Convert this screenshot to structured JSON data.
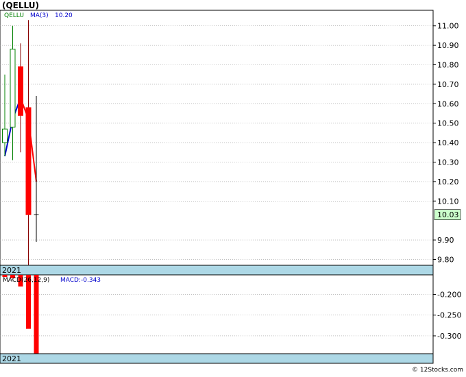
{
  "title": "(QELLU)",
  "copyright": "© 12Stocks.com",
  "chart_data": [
    {
      "type": "candlestick",
      "legend": {
        "symbol": "QELLU",
        "ma_label": "MA(3)",
        "ma_value": "10.20"
      },
      "ylim": [
        9.77,
        11.08
      ],
      "yticks": [
        11.0,
        10.9,
        10.8,
        10.7,
        10.6,
        10.5,
        10.4,
        10.3,
        10.2,
        10.1,
        9.9,
        9.8
      ],
      "ytick_labels": [
        "11.00",
        "10.90",
        "10.80",
        "10.70",
        "10.60",
        "10.50",
        "10.40",
        "10.30",
        "10.20",
        "10.10",
        "9.90",
        "9.80"
      ],
      "last_price_label": "10.03",
      "last_price": 10.03,
      "year_label": "2021",
      "candles": [
        {
          "open": 10.4,
          "high": 10.75,
          "low": 10.33,
          "close": 10.47,
          "direction": "up"
        },
        {
          "open": 10.48,
          "high": 11.0,
          "low": 10.31,
          "close": 10.88,
          "direction": "up"
        },
        {
          "open": 10.79,
          "high": 10.91,
          "low": 10.35,
          "close": 10.54,
          "direction": "down"
        },
        {
          "open": 10.58,
          "high": 11.03,
          "low": 9.77,
          "close": 10.03,
          "direction": "down"
        },
        {
          "open": 10.03,
          "high": 10.64,
          "low": 9.89,
          "close": 10.03,
          "direction": "flat"
        }
      ],
      "ma": [
        {
          "i": 0,
          "v": 10.33
        },
        {
          "i": 1,
          "v": 10.52
        },
        {
          "i": 2,
          "v": 10.63
        },
        {
          "i": 3,
          "v": 10.52
        },
        {
          "i": 4,
          "v": 10.2
        }
      ],
      "colors": {
        "up": "#008000",
        "down": "#ff0000",
        "flat": "#000000",
        "ma_up": "#0000cc",
        "ma_down": "#ff0000",
        "grid": "#999999",
        "bar": "#add8e6",
        "last_price_bg": "#ccffcc"
      }
    },
    {
      "type": "bar",
      "legend": {
        "name": "MACD(26,12,9)",
        "value_label": "MACD:-0.343"
      },
      "ylim": [
        -0.343,
        -0.153
      ],
      "yticks": [
        -0.2,
        -0.25,
        -0.3
      ],
      "ytick_labels": [
        "-0.200",
        "-0.250",
        "-0.300"
      ],
      "year_label": "2021",
      "values": [
        -0.158,
        -0.161,
        -0.181,
        -0.283,
        -0.343
      ],
      "colors": {
        "bar": "#ff0000",
        "grid": "#999999",
        "band": "#add8e6"
      }
    }
  ]
}
